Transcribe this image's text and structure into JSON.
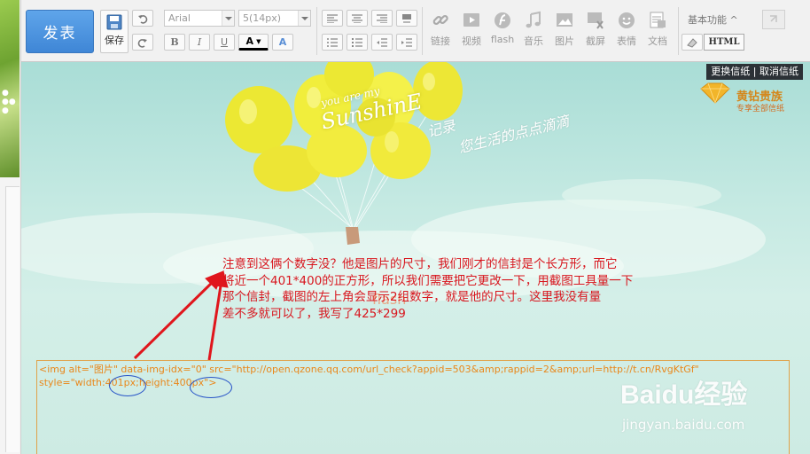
{
  "toolbar": {
    "publish_label": "发表",
    "save_label": "保存",
    "font_family": "Arial",
    "font_size": "5(14px)",
    "bold": "B",
    "italic": "I",
    "underline": "U",
    "font_color": "A",
    "font_bg": "A",
    "media_tools": [
      {
        "label": "链接",
        "icon": "link-icon"
      },
      {
        "label": "视频",
        "icon": "video-icon"
      },
      {
        "label": "flash",
        "icon": "flash-icon"
      },
      {
        "label": "音乐",
        "icon": "music-icon"
      },
      {
        "label": "图片",
        "icon": "image-icon"
      },
      {
        "label": "截屏",
        "icon": "screenshot-icon"
      },
      {
        "label": "表情",
        "icon": "emoticon-icon"
      },
      {
        "label": "文档",
        "icon": "document-icon"
      }
    ],
    "feature_label": "基本功能 ^",
    "html_label": "HTML"
  },
  "canvas": {
    "change_stationery": "更换信纸",
    "cancel_stationery": "取消信纸",
    "vip_title": "黄钻贵族",
    "vip_sub": "专享全部信纸",
    "slogan_line1": "记录",
    "slogan_line2": "您生活的点点滴滴",
    "balloon_text_small": "you are my",
    "balloon_text_big": "SunshinE",
    "note_lines": [
      "注意到这俩个数字没？他是图片的尺寸，我们刚才的信封是个长方形，而它",
      "将近一个401*400的正方形，所以我们需要把它更改一下，用截图工具量一下",
      "那个信封，截图的左上角会显示2组数字，就是他的尺寸。这里我没有量",
      "差不多就可以了，我写了425*299"
    ],
    "ghost_flash": "flash",
    "code_line1": "<img alt=\"图片\" data-img-idx=\"0\" src=\"http://open.qzone.qq.com/url_check?appid=503&amp;rappid=2&amp;url=http://t.cn/RvgKtGf\"",
    "code_line2": "style=\"width:401px;height:400px\">"
  },
  "watermark": {
    "brand": "Baidu经验",
    "sub": "jingyan.baidu.com"
  },
  "colors": {
    "publish_blue": "#3f86d6",
    "note_red": "#d8161e",
    "code_orange": "#e9881c",
    "annotation_circle": "#2854c8",
    "arrow_red": "#e0161c"
  }
}
